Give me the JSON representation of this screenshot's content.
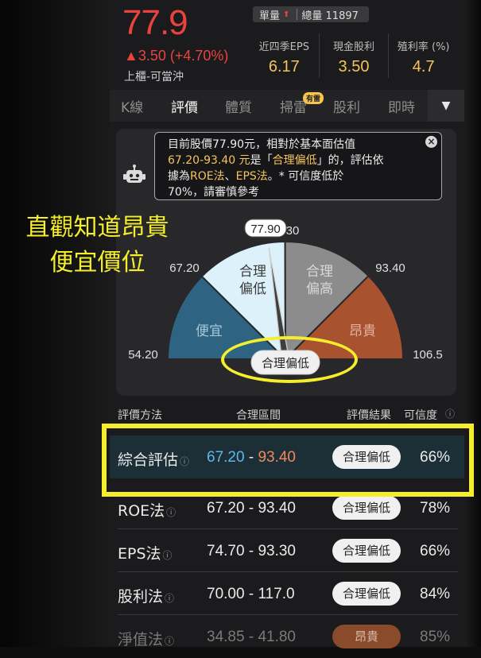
{
  "header": {
    "price": "77.9",
    "change": "▲3.50 (+4.70%)",
    "board": "上櫃-可當沖",
    "volume_label": "單量",
    "total_volume": "總量 11897",
    "metrics": [
      {
        "label": "近四季EPS",
        "value": "6.17"
      },
      {
        "label": "現金股利",
        "value": "3.50"
      },
      {
        "label": "殖利率 (%)",
        "value": "4.7"
      }
    ]
  },
  "tabs": [
    {
      "label": "K線",
      "active": false
    },
    {
      "label": "評價",
      "active": true
    },
    {
      "label": "體質",
      "active": false
    },
    {
      "label": "掃雷",
      "active": false
    },
    {
      "label": "股利",
      "active": false
    },
    {
      "label": "即時",
      "active": false
    }
  ],
  "tab_badge": "有雷",
  "bubble": {
    "line1": "目前股價77.90元，相對於基本面估值",
    "range": "67.20-93.40 元",
    "mid1": "是「",
    "verdict": "合理偏低",
    "mid2": "」的，評估依",
    "line3a": "據為",
    "method1": "ROE法",
    "sep": "、",
    "method2": "EPS法",
    "line3b": "。* 可信度低於",
    "line4": "70%，請審慎參考"
  },
  "gauge": {
    "current_label": "77.90",
    "peek_label": "30",
    "scale_min": "54.20",
    "scale_low": "67.20",
    "scale_high": "93.40",
    "scale_max": "106.5",
    "min": 54.2,
    "low": 67.2,
    "high": 93.4,
    "max": 106.5,
    "current": 77.9,
    "zones": [
      {
        "line1": "便宜",
        "line2": "",
        "color": "#2e6482"
      },
      {
        "line1": "合理",
        "line2": "偏低",
        "color": "#ddf1fb"
      },
      {
        "line1": "合理",
        "line2": "偏高",
        "color": "#8c8c8c"
      },
      {
        "line1": "昂貴",
        "line2": "",
        "color": "#a8522f"
      }
    ],
    "verdict_pill": "合理偏低"
  },
  "annotation": {
    "line1": "直觀知道昂貴",
    "line2": "便宜價位"
  },
  "table": {
    "headers": [
      "評價方法",
      "合理區間",
      "評價結果",
      "可信度"
    ],
    "rows": [
      {
        "method": "綜合評估",
        "low": "67.20",
        "dash": " - ",
        "high": "93.40",
        "result": "合理偏低",
        "confidence": "66%"
      },
      {
        "method": "ROE法",
        "low": "67.20",
        "dash": " - ",
        "high": "93.40",
        "result": "合理偏低",
        "confidence": "78%"
      },
      {
        "method": "EPS法",
        "low": "74.70",
        "dash": " - ",
        "high": "93.30",
        "result": "合理偏低",
        "confidence": "66%"
      },
      {
        "method": "股利法",
        "low": "70.00",
        "dash": " - ",
        "high": "117.0",
        "result": "合理偏低",
        "confidence": "84%"
      },
      {
        "method": "淨值法",
        "low": "34.85",
        "dash": " - ",
        "high": "41.80",
        "result": "昂貴",
        "confidence": "85%"
      }
    ]
  },
  "colors": {
    "up": "#e8433f",
    "gold": "#f4c45b",
    "highlight": "#f5ee2d",
    "low_value": "#5db8ea",
    "high_value": "#f08a5d"
  }
}
